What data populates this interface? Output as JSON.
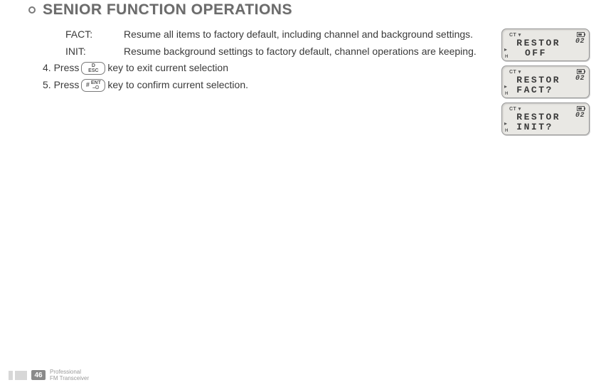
{
  "title": "SENIOR FUNCTION OPERATIONS",
  "defs": [
    {
      "label": "FACT:",
      "desc": "Resume all items to factory default, including channel and background settings."
    },
    {
      "label": "INIT:",
      "desc": "Resume background settings to factory default, channel operations are keeping."
    }
  ],
  "steps": [
    {
      "num": "4. Press",
      "key_top": "D",
      "key_bot": "ESC",
      "tail": " key to exit current selection"
    },
    {
      "num": "5. Press",
      "key_left": "#",
      "key_right_top": "ENT",
      "key_right_bot": "⎯⊙",
      "tail": " key to confirm current selection."
    }
  ],
  "lcd": {
    "top_left": "CT ▾",
    "channel": "02",
    "h": "H",
    "screens": [
      {
        "line1": " RESTOR",
        "line2_centered": "OFF"
      },
      {
        "line1": " RESTOR",
        "line2": " FACT?"
      },
      {
        "line1": " RESTOR",
        "line2": " INIT?"
      }
    ]
  },
  "footer": {
    "page": "46",
    "line1": "Professional",
    "line2": "FM Transceiver"
  }
}
